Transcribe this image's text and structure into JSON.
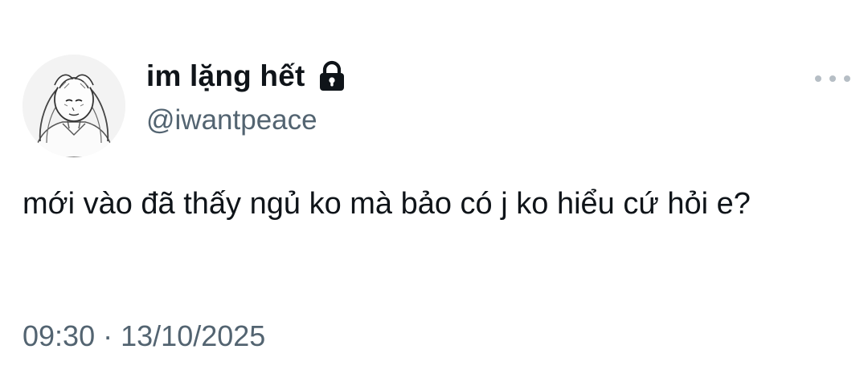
{
  "author": {
    "display_name": "im lặng hết",
    "handle": "@iwantpeace",
    "avatar_icon": "sketch-person-holding-head-avatar",
    "protected_icon": "lock-icon"
  },
  "actions": {
    "more_icon": "more-horizontal-icon"
  },
  "tweet": {
    "text": "mới vào đã thấy ngủ ko mà bảo có j ko hiểu cứ hỏi e?",
    "time": "09:30",
    "separator": "·",
    "date": "13/10/2025"
  },
  "colors": {
    "text_primary": "#0f1419",
    "text_secondary": "#536471",
    "background": "#ffffff"
  }
}
